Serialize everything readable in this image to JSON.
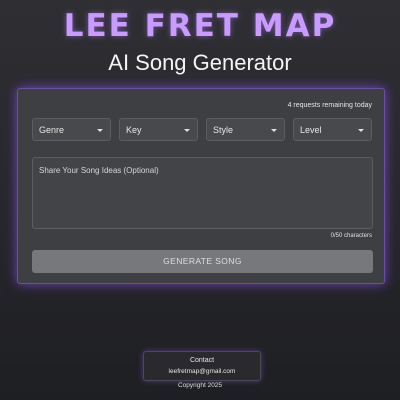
{
  "header": {
    "brand": "LEE FRET MAP",
    "subtitle": "AI Song Generator"
  },
  "form": {
    "requests_remaining": "4 requests remaining today",
    "selects": [
      {
        "label": "Genre"
      },
      {
        "label": "Key"
      },
      {
        "label": "Style"
      },
      {
        "label": "Level"
      }
    ],
    "ideas_placeholder": "Share Your Song Ideas (Optional)",
    "char_count": "0/50 characters",
    "generate_label": "GENERATE SONG"
  },
  "footer": {
    "contact_title": "Contact",
    "email": "leefretmap@gmail.com",
    "copyright": "Copyright 2025"
  },
  "colors": {
    "brand": "#c99bff",
    "accent_glow": "#8a5cff",
    "panel": "#3e3f42",
    "button": "#77787c"
  },
  "icons": {
    "dropdown": "chevron-down-icon"
  }
}
